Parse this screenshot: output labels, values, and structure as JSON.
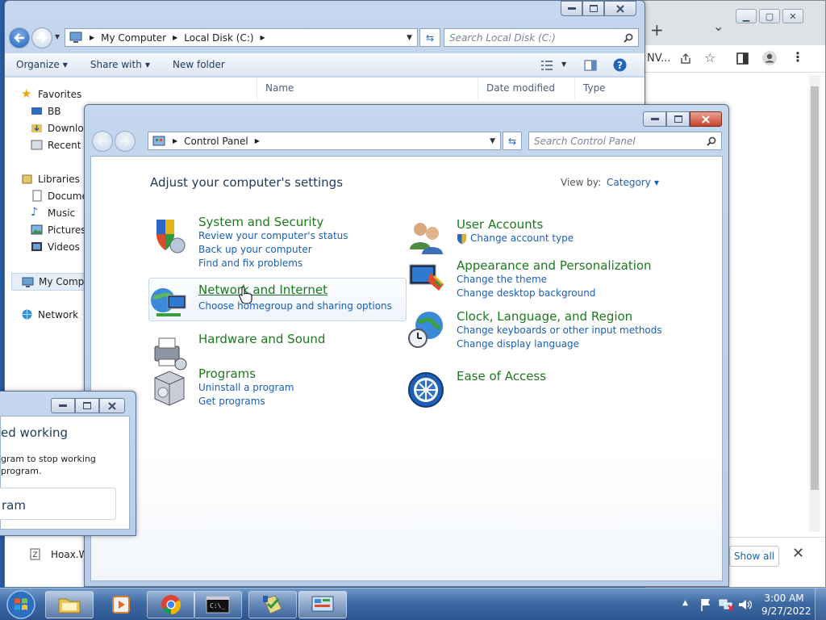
{
  "chrome": {
    "tab_partial": "NV...",
    "show_all": "Show all",
    "plus": "+",
    "chevron": "⌄"
  },
  "explorer": {
    "breadcrumb": [
      "My Computer",
      "Local Disk (C:)"
    ],
    "search_placeholder": "Search Local Disk (C:)",
    "cmd": {
      "organize": "Organize",
      "share": "Share with",
      "new_folder": "New folder"
    },
    "columns": {
      "name": "Name",
      "date": "Date modified",
      "type": "Type"
    },
    "nav": {
      "favorites": "Favorites",
      "bb": "BB",
      "downloads": "Downloa",
      "recent": "Recent P",
      "libraries": "Libraries",
      "documents": "Docume",
      "music": "Music",
      "pictures": "Pictures",
      "videos": "Videos",
      "mycomputer": "My Compu",
      "network": "Network",
      "file_partial": "Hoax.W"
    }
  },
  "cpanel": {
    "breadcrumb": "Control Panel",
    "search_placeholder": "Search Control Panel",
    "heading": "Adjust your computer's settings",
    "view_by_label": "View by:",
    "view_by_value": "Category",
    "left": [
      {
        "title": "System and Security",
        "links": [
          "Review your computer's status",
          "Back up your computer",
          "Find and fix problems"
        ]
      },
      {
        "title": "Network and Internet",
        "links": [
          "Choose homegroup and sharing options"
        ]
      },
      {
        "title": "Hardware and Sound",
        "links": []
      },
      {
        "title": "Programs",
        "links": [
          "Uninstall a program",
          "Get programs"
        ]
      }
    ],
    "right": [
      {
        "title": "User Accounts",
        "links": [
          "Change account type"
        ]
      },
      {
        "title": "Appearance and Personalization",
        "links": [
          "Change the theme",
          "Change desktop background"
        ]
      },
      {
        "title": "Clock, Language, and Region",
        "links": [
          "Change keyboards or other input methods",
          "Change display language"
        ]
      },
      {
        "title": "Ease of Access",
        "links": []
      }
    ]
  },
  "dialog": {
    "title_partial": "ed working",
    "text_line1": "gram to stop working",
    "text_line2": "program.",
    "option_partial": "ram"
  },
  "taskbar": {
    "time": "3:00 AM",
    "date": "9/27/2022"
  },
  "colors": {
    "link_blue": "#1a5fb4",
    "category_green": "#1c7a1c",
    "heading_navy": "#1e395b"
  }
}
